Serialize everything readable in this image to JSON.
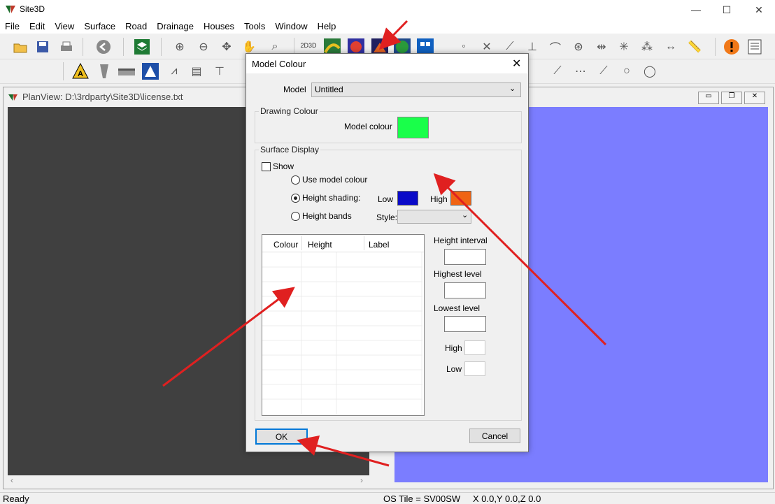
{
  "window": {
    "title": "Site3D",
    "minimize_icon": "—",
    "maximize_icon": "☐",
    "close_icon": "✕"
  },
  "menu": [
    "File",
    "Edit",
    "View",
    "Surface",
    "Road",
    "Drainage",
    "Houses",
    "Tools",
    "Window",
    "Help"
  ],
  "toolbar": {
    "mode_2d3d": "2D3D"
  },
  "planview": {
    "title": "PlanView: D:\\3rdparty\\Site3D\\license.txt"
  },
  "statusbar": {
    "status": "Ready",
    "os_tile": "OS Tile = SV00SW",
    "coords": "X 0.0,Y 0.0,Z 0.0"
  },
  "dialog": {
    "title": "Model Colour",
    "model_label": "Model",
    "model_value": "Untitled",
    "drawing_colour_group": "Drawing Colour",
    "model_colour_label": "Model colour",
    "surface_display_group": "Surface Display",
    "show_label": "Show",
    "use_model_colour": "Use model colour",
    "height_shading": "Height shading:",
    "height_bands": "Height bands",
    "low_label": "Low",
    "high_label": "High",
    "style_label": "Style:",
    "table_headers": [
      "Colour",
      "Height",
      "Label"
    ],
    "height_interval": "Height interval",
    "highest_level": "Highest level",
    "lowest_level": "Lowest level",
    "high_small": "High",
    "low_small": "Low",
    "ok": "OK",
    "cancel": "Cancel"
  },
  "colors": {
    "model_colour": "#19ff4a",
    "low_colour": "#0a0ac8",
    "high_colour": "#f06414",
    "annotation_arrow": "#e02020"
  }
}
